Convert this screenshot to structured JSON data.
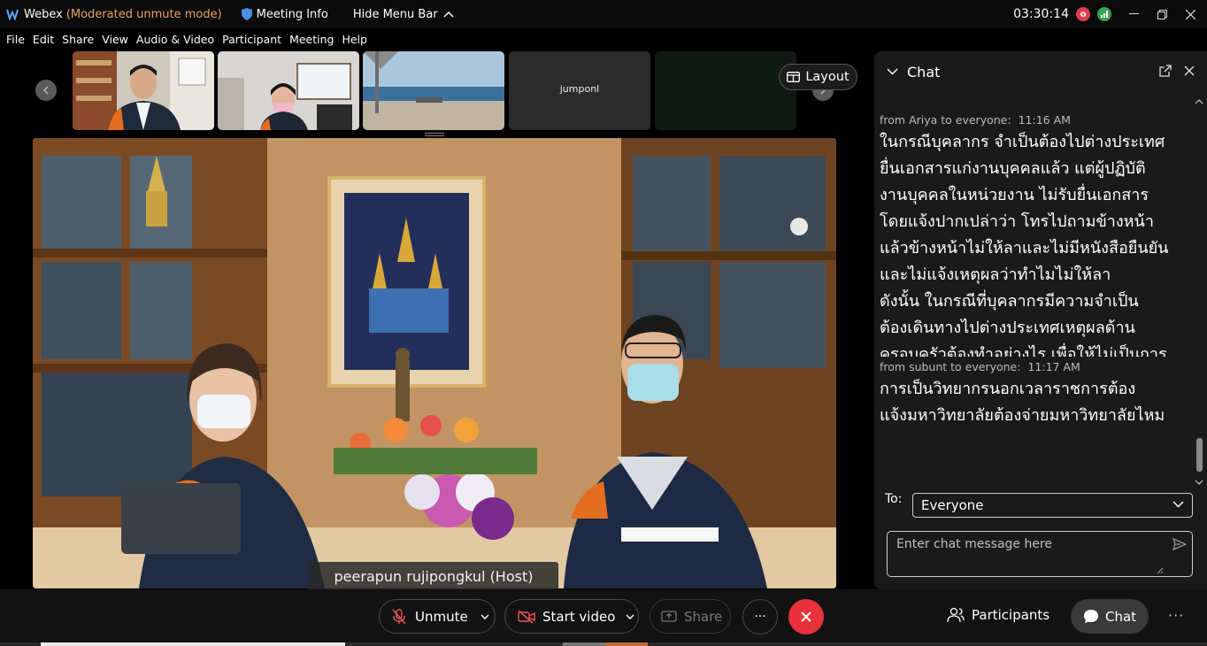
{
  "titlebar": {
    "app_name": "Webex",
    "mode": "(Moderated unmute mode)",
    "meeting_info": "Meeting Info",
    "hide_menu_bar": "Hide Menu Bar",
    "time": "03:30:14",
    "badge_letter": "o"
  },
  "menu": {
    "items": [
      "File",
      "Edit",
      "Share",
      "View",
      "Audio & Video",
      "Participant",
      "Meeting",
      "Help"
    ]
  },
  "thumbnails": {
    "jumponl_label": "jumponl"
  },
  "layout_button": "Layout",
  "main_video": {
    "name_tag": "peerapun rujipongkul (Host)"
  },
  "chat": {
    "title": "Chat",
    "messages": [
      {
        "meta": "from Ariya to everyone:",
        "time": "11:16 AM",
        "body": "ในกรณีบุคลากร จำเป็นต้องไปต่างประเทศ\nยื่นเอกสารแก่งานบุคคลแล้ว แต่ผู้ปฏิบัติ\nงานบุคคลในหน่วยงาน ไม่รับยื่นเอกสาร\nโดยแจ้งปากเปล่าว่า โทรไปถามข้างหน้า\nแล้วข้างหน้าไม่ให้ลาและไม่มีหนังสือยืนยัน\nและไม่แจ้งเหตุผลว่าทำไมไม่ให้ลา\nดังนั้น ในกรณีที่บุคลากรมีความจำเป็น\nต้องเดินทางไปต่างประเทศเหตุผลด้าน\nครอบครัวต้องทำอย่างไร เพื่อให้ไม่เป็นการ"
      },
      {
        "meta": "from subunt to everyone:",
        "time": "11:17 AM",
        "body": "การเป็นวิทยากรนอกเวลาราชการต้อง\nแจ้งมหาวิทยาลัยต้องจ่ายมหาวิทยาลัยไหม"
      }
    ],
    "to_label": "To:",
    "to_value": "Everyone",
    "input_placeholder": "Enter chat message here"
  },
  "toolbar": {
    "unmute": "Unmute",
    "start_video": "Start video",
    "share": "Share",
    "more": "···",
    "participants": "Participants",
    "chat": "Chat",
    "overflow": "···"
  },
  "colors": {
    "mode": "#e9a25f",
    "end_call": "#e8313b",
    "accent_green": "#3aa457",
    "badge_red": "#e23a4c"
  }
}
